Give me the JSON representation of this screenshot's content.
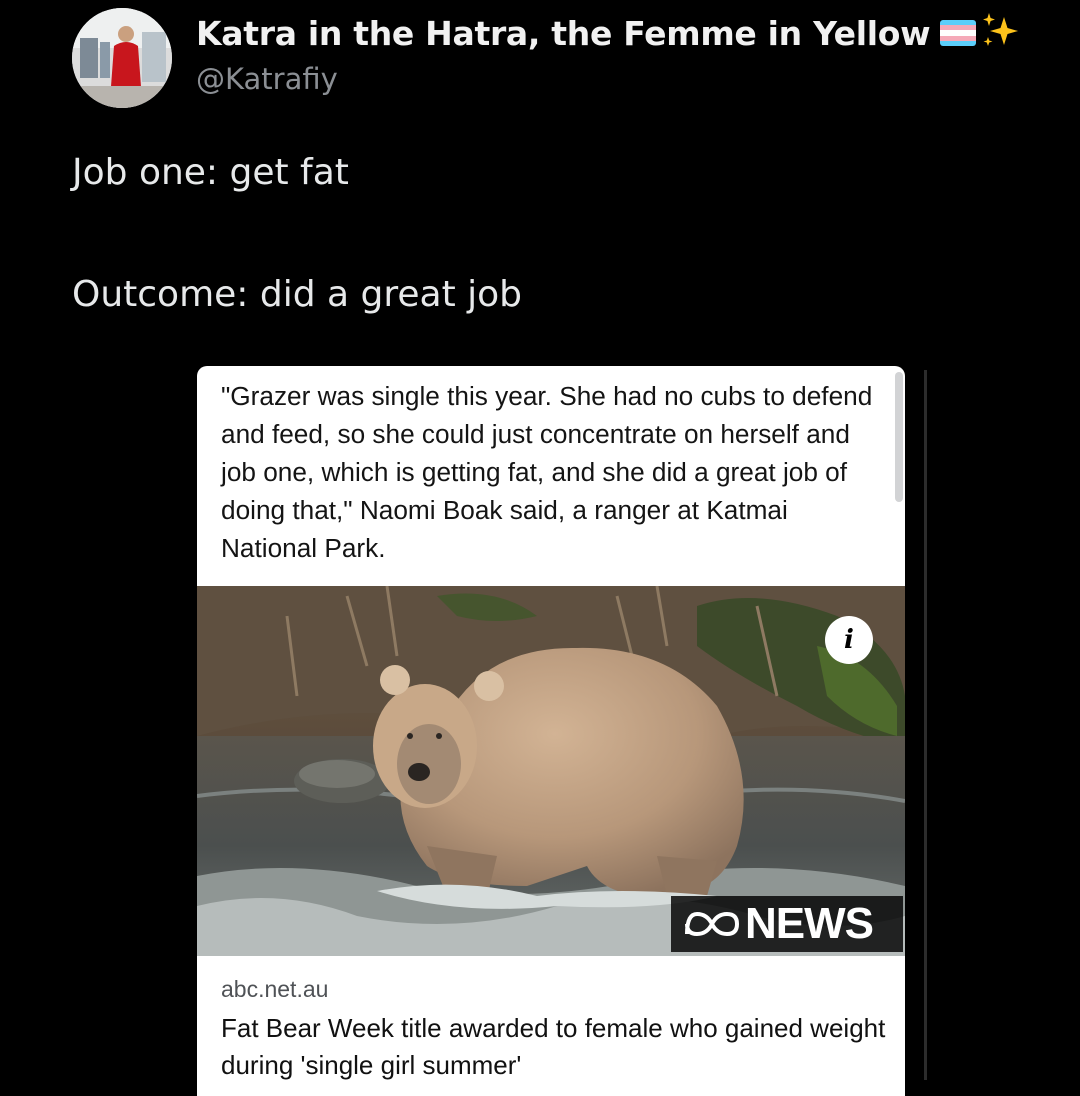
{
  "tweet": {
    "author": {
      "display_name": "Katra in the Hatra, the Femme in Yellow",
      "handle": "@Katrafiy",
      "badges": [
        "transgender-flag-emoji",
        "sparkles-emoji"
      ]
    },
    "lines": [
      "Job one: get fat",
      "Outcome: did a great job"
    ]
  },
  "card": {
    "quote": "\"Grazer was single this year. She had no cubs to defend and feed, so she could just concentrate on herself and job one, which is getting fat, and she did a great job of doing that,\" Naomi Boak said, a ranger at Katmai National Park.",
    "image": {
      "subject": "bear-photo",
      "info_icon": "info-icon",
      "watermark": "NEWS"
    },
    "domain": "abc.net.au",
    "headline": "Fat Bear Week title awarded to female who gained weight during 'single girl summer'"
  },
  "colors": {
    "background": "#000000",
    "text_primary": "#e7e9ea",
    "text_secondary": "#8b8f94",
    "card_background": "#ffffff"
  }
}
